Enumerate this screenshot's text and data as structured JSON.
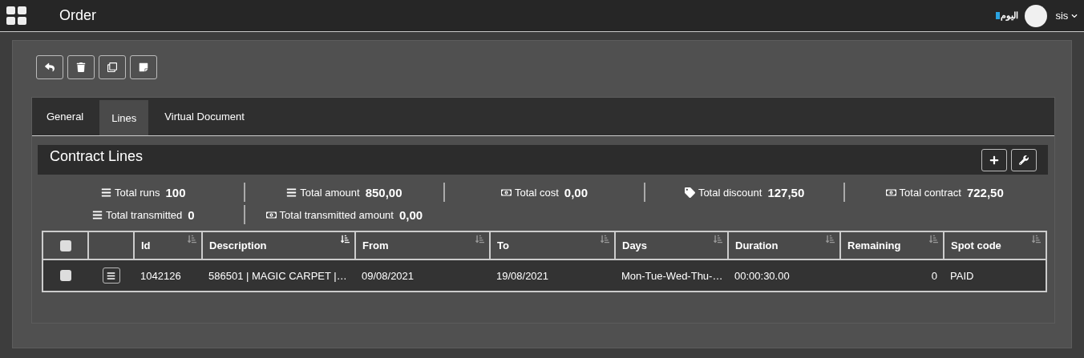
{
  "header": {
    "title": "Order",
    "brand": "اليوم",
    "user": "sis"
  },
  "toolbar": [
    {
      "kind": "reply"
    },
    {
      "kind": "delete"
    },
    {
      "kind": "copy"
    },
    {
      "kind": "note"
    }
  ],
  "tabs": [
    {
      "label": "General",
      "selected": false
    },
    {
      "label": "Lines",
      "selected": true
    },
    {
      "label": "Virtual Document",
      "selected": false
    }
  ],
  "section": {
    "title": "Contract Lines",
    "actions": [
      {
        "kind": "add"
      },
      {
        "kind": "settings"
      }
    ]
  },
  "stats": [
    [
      {
        "kind": "list",
        "label": "Total runs",
        "value": "100"
      },
      {
        "kind": "list",
        "label": "Total amount",
        "value": "850,00"
      },
      {
        "kind": "money",
        "label": "Total cost",
        "value": "0,00"
      },
      {
        "kind": "tag",
        "label": "Total discount",
        "value": "127,50"
      },
      {
        "kind": "money",
        "label": "Total contract",
        "value": "722,50"
      }
    ],
    [
      {
        "kind": "list",
        "label": "Total transmitted",
        "value": "0"
      },
      {
        "kind": "money",
        "label": "Total transmitted amount",
        "value": "0,00"
      }
    ]
  ],
  "table": {
    "select_all": {
      "checked": false
    },
    "columns": [
      {
        "label": "Id",
        "sorted": false
      },
      {
        "label": "Description",
        "sorted": true
      },
      {
        "label": "From",
        "sorted": false
      },
      {
        "label": "To",
        "sorted": false
      },
      {
        "label": "Days",
        "sorted": false
      },
      {
        "label": "Duration",
        "sorted": false
      },
      {
        "label": "Remaining",
        "sorted": false
      },
      {
        "label": "Spot code",
        "sorted": false
      }
    ],
    "rows": [
      {
        "checked": false,
        "cells": [
          "1042126",
          "586501 | MAGIC CARPET |…",
          "09/08/2021",
          "19/08/2021",
          "Mon-Tue-Wed-Thu-…",
          "00:00:30.00",
          "0",
          "PAID"
        ]
      }
    ]
  }
}
